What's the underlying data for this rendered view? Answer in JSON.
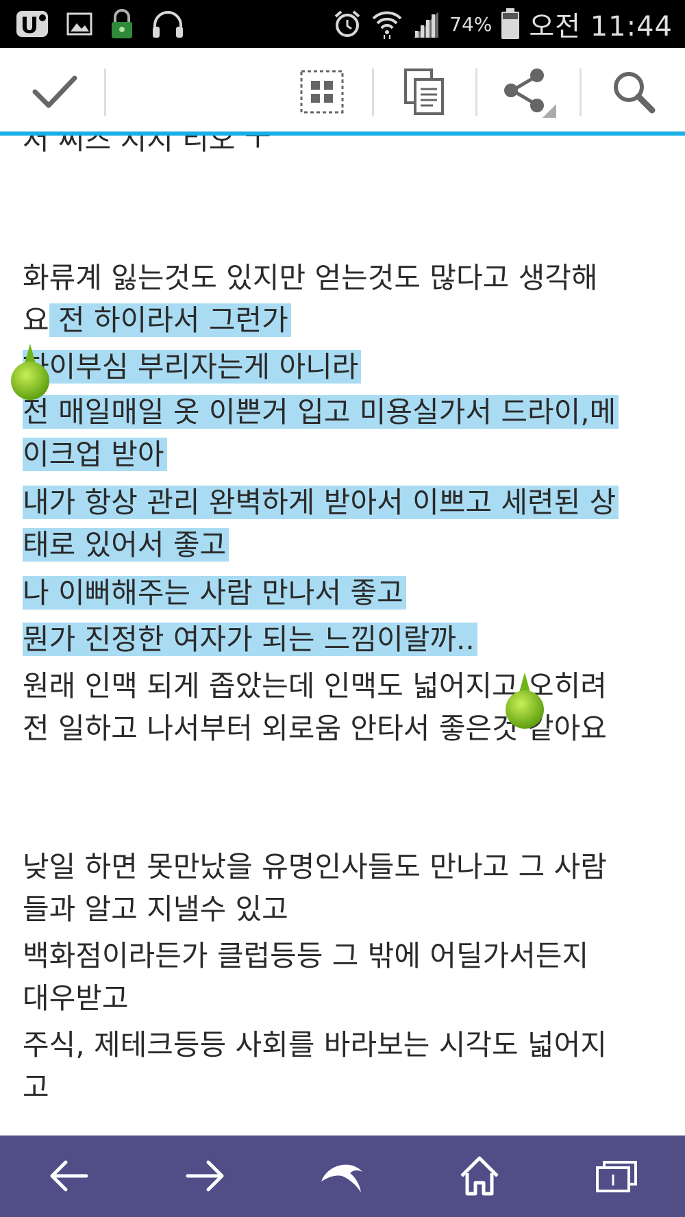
{
  "status_bar": {
    "battery_percent": "74%",
    "time": "오전 11:44",
    "icons": [
      "uplus-icon",
      "gallery-icon",
      "lock-icon",
      "headset-icon",
      "alarm-icon",
      "wifi-icon",
      "signal-icon",
      "battery-icon"
    ]
  },
  "action_bar": {
    "icons": [
      "check-icon",
      "select-all-icon",
      "copy-icon",
      "share-icon",
      "search-icon"
    ],
    "accent_color": "#1aaee6"
  },
  "content": {
    "partial_top_line": "저 씨즈 지지 리오 ㅜ",
    "lines": [
      {
        "text": "화류계 잃는것도 있지만 얻는것도 많다고 생각해",
        "highlight_prefix": "",
        "highlight": ""
      },
      {
        "text": "요",
        "highlight": " 전 하이라서 그런가"
      },
      {
        "text": "",
        "highlight": "하이부심 부리자는게 아니라"
      },
      {
        "text": "",
        "highlight": "전 매일매일 옷 이쁜거 입고 미용실가서 드라이,메"
      },
      {
        "text": "",
        "highlight": "이크업 받아 "
      },
      {
        "text": "",
        "highlight": "내가 항상 관리 완벽하게 받아서 이쁘고 세련된 상"
      },
      {
        "text": "",
        "highlight": "태로 있어서 좋고"
      },
      {
        "text": "",
        "highlight": "나 이뻐해주는 사람 만나서 좋고"
      },
      {
        "text": "",
        "highlight": "뭔가 진정한 여자가 되는 느낌이랄까.."
      },
      {
        "text": "원래 인맥 되게 좁았는데 인맥도 넓어지고 오히려",
        "highlight": ""
      },
      {
        "text": "전 일하고 나서부터 외로움 안타서 좋은것 같아요",
        "highlight": ""
      },
      {
        "text": "낮일 하면 못만났을 유명인사들도 만나고 그 사람",
        "highlight": ""
      },
      {
        "text": "들과 알고 지낼수 있고",
        "highlight": ""
      },
      {
        "text": "백화점이라든가 클럽등등 그 밖에 어딜가서든지",
        "highlight": ""
      },
      {
        "text": "대우받고",
        "highlight": ""
      },
      {
        "text": "주식, 제테크등등 사회를 바라보는 시각도 넓어지",
        "highlight": ""
      },
      {
        "text": "고",
        "highlight": ""
      }
    ],
    "highlight_color": "#a9dcf3",
    "handle_color": "#7cc21a"
  },
  "bottom_bar": {
    "icons": [
      "back-arrow-icon",
      "forward-arrow-icon",
      "dolphin-icon",
      "home-icon",
      "tabs-icon"
    ],
    "color": "#504d87"
  }
}
